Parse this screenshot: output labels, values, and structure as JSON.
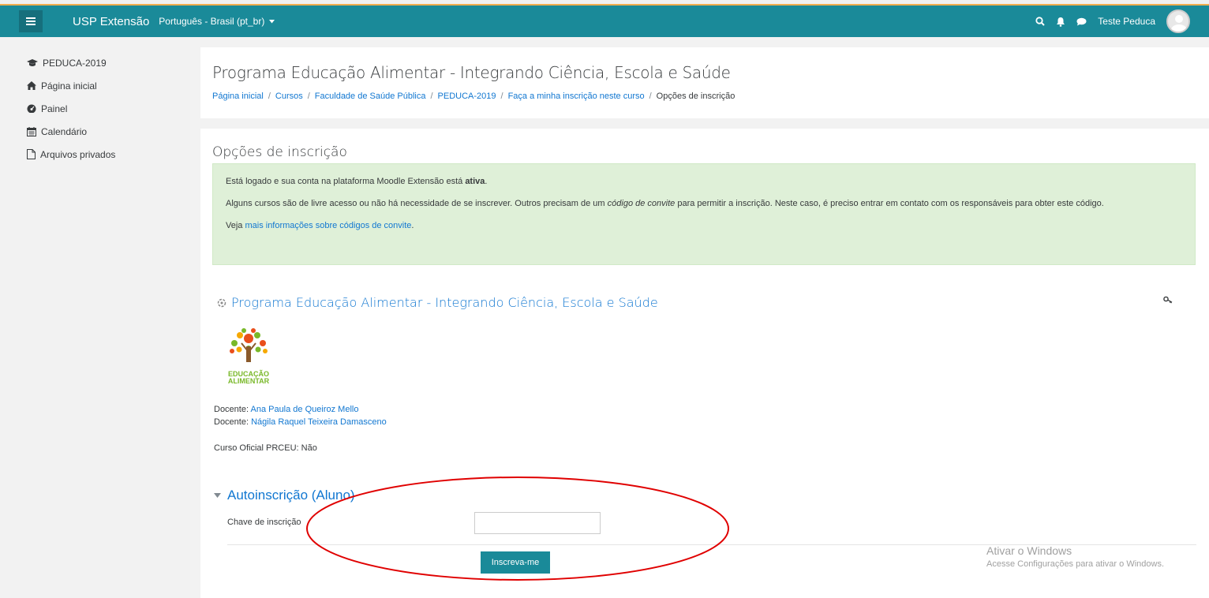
{
  "navbar": {
    "site_name": "USP Extensão",
    "language": "Português - Brasil (pt_br)",
    "user_name": "Teste Peduca"
  },
  "sidebar": {
    "items": [
      {
        "label": "PEDUCA-2019",
        "icon": "graduation-cap-icon"
      },
      {
        "label": "Página inicial",
        "icon": "home-icon"
      },
      {
        "label": "Painel",
        "icon": "dashboard-icon"
      },
      {
        "label": "Calendário",
        "icon": "calendar-icon"
      },
      {
        "label": "Arquivos privados",
        "icon": "file-icon"
      }
    ]
  },
  "header": {
    "title": "Programa Educação Alimentar - Integrando Ciência, Escola e Saúde",
    "breadcrumb": [
      "Página inicial",
      "Cursos",
      "Faculdade de Saúde Pública",
      "PEDUCA-2019",
      "Faça a minha inscrição neste curso",
      "Opções de inscrição"
    ]
  },
  "main": {
    "section_title": "Opções de inscrição",
    "alert": {
      "line1_prefix": "Está logado e sua conta na plataforma Moodle Extensão está ",
      "line1_bold": "ativa",
      "line1_suffix": ".",
      "line2_prefix": "Alguns cursos são de livre acesso ou não há necessidade de se inscrever. Outros precisam de um ",
      "line2_italic": "código de convite",
      "line2_suffix": " para permitir a inscrição. Neste caso, é preciso entrar em contato com os responsáveis para obter este código.",
      "line3_prefix": "Veja ",
      "line3_link": "mais informações sobre códigos de convite",
      "line3_suffix": "."
    },
    "course": {
      "name": "Programa Educação Alimentar - Integrando Ciência, Escola e Saúde",
      "logo_text_1": "EDUCAÇÃO",
      "logo_text_2": "ALIMENTAR",
      "teacher_label": "Docente: ",
      "teachers": [
        "Ana Paula de Queiroz Mello",
        "Nágila Raquel Teixeira Damasceno"
      ],
      "official": "Curso Oficial PRCEU: Não"
    },
    "enrol": {
      "header": "Autoinscrição (Aluno)",
      "key_label": "Chave de inscrição",
      "key_value": "",
      "submit_label": "Inscreva-me"
    }
  },
  "watermark": {
    "title": "Ativar o Windows",
    "subtitle": "Acesse Configurações para ativar o Windows."
  },
  "colors": {
    "navbar": "#1a8a99",
    "link": "#1177d1",
    "alert_bg": "#dff0d8",
    "annotation": "#e00000"
  }
}
